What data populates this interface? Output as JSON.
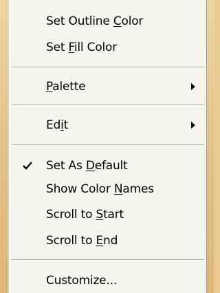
{
  "menu": {
    "items": [
      {
        "pre": "Set Outline ",
        "mnemonic": "C",
        "post": "olor",
        "checked": false,
        "submenu": false
      },
      {
        "pre": "Set ",
        "mnemonic": "F",
        "post": "ill Color",
        "checked": false,
        "submenu": false
      },
      {
        "pre": "",
        "mnemonic": "P",
        "post": "alette",
        "checked": false,
        "submenu": true
      },
      {
        "pre": "Ed",
        "mnemonic": "i",
        "post": "t",
        "checked": false,
        "submenu": true
      },
      {
        "pre": "Set As ",
        "mnemonic": "D",
        "post": "efault",
        "checked": true,
        "submenu": false
      },
      {
        "pre": "Show Color ",
        "mnemonic": "N",
        "post": "ames",
        "checked": false,
        "submenu": false
      },
      {
        "pre": "Scroll to ",
        "mnemonic": "S",
        "post": "tart",
        "checked": false,
        "submenu": false
      },
      {
        "pre": "Scroll to ",
        "mnemonic": "E",
        "post": "nd",
        "checked": false,
        "submenu": false
      },
      {
        "pre": "Customize...",
        "mnemonic": "",
        "post": "",
        "checked": false,
        "submenu": false
      }
    ],
    "icons": {
      "check": "checkmark-icon",
      "submenu_arrow": "submenu-arrow-icon"
    }
  }
}
